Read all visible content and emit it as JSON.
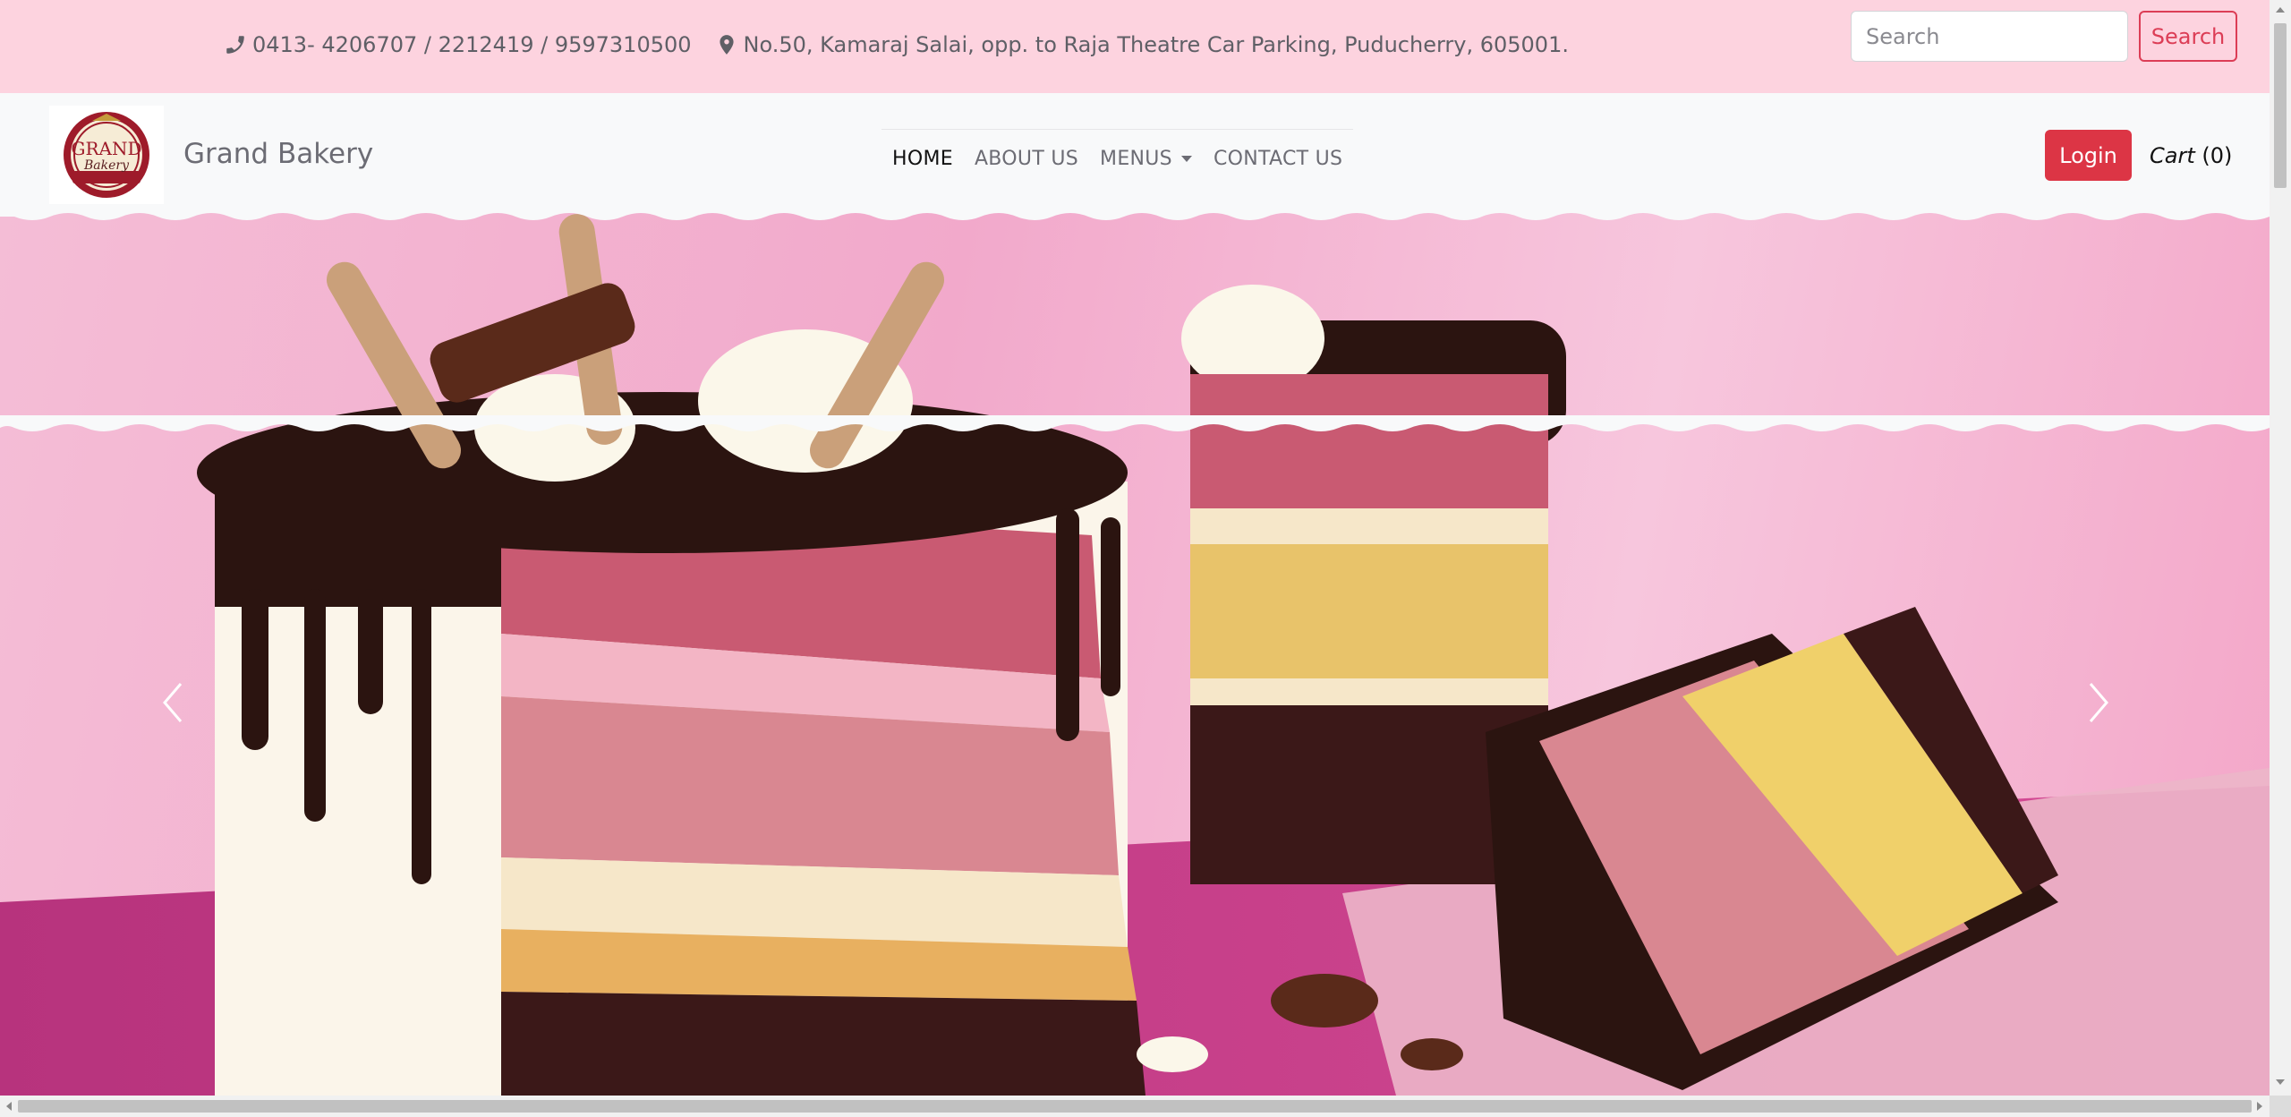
{
  "topbar": {
    "phone_icon": "phone-icon",
    "phone": "0413- 4206707 / 2212419 / 9597310500",
    "location_icon": "map-marker-icon",
    "address": "No.50, Kamaraj Salai, opp. to Raja Theatre Car Parking, Puducherry, 605001.",
    "search": {
      "placeholder": "Search",
      "value": "",
      "button_label": "Search"
    }
  },
  "navbar": {
    "logo": {
      "text_top": "GRAND",
      "text_bottom": "Bakery"
    },
    "brand": "Grand Bakery",
    "menu": [
      {
        "label": "HOME",
        "active": true
      },
      {
        "label": "ABOUT US",
        "active": false
      },
      {
        "label": "MENUS",
        "active": false,
        "dropdown": true
      },
      {
        "label": "CONTACT US",
        "active": false
      }
    ],
    "login_label": "Login",
    "cart": {
      "label": "Cart",
      "count": "(0)"
    }
  },
  "hero": {
    "controls": {
      "prev_icon": "chevron-left-icon",
      "next_icon": "chevron-right-icon"
    }
  },
  "colors": {
    "topbar_bg": "#fdd3df",
    "navbar_bg": "#f8f9fa",
    "accent_red": "#dc3545",
    "hero_pink": "#f2a9cb"
  }
}
